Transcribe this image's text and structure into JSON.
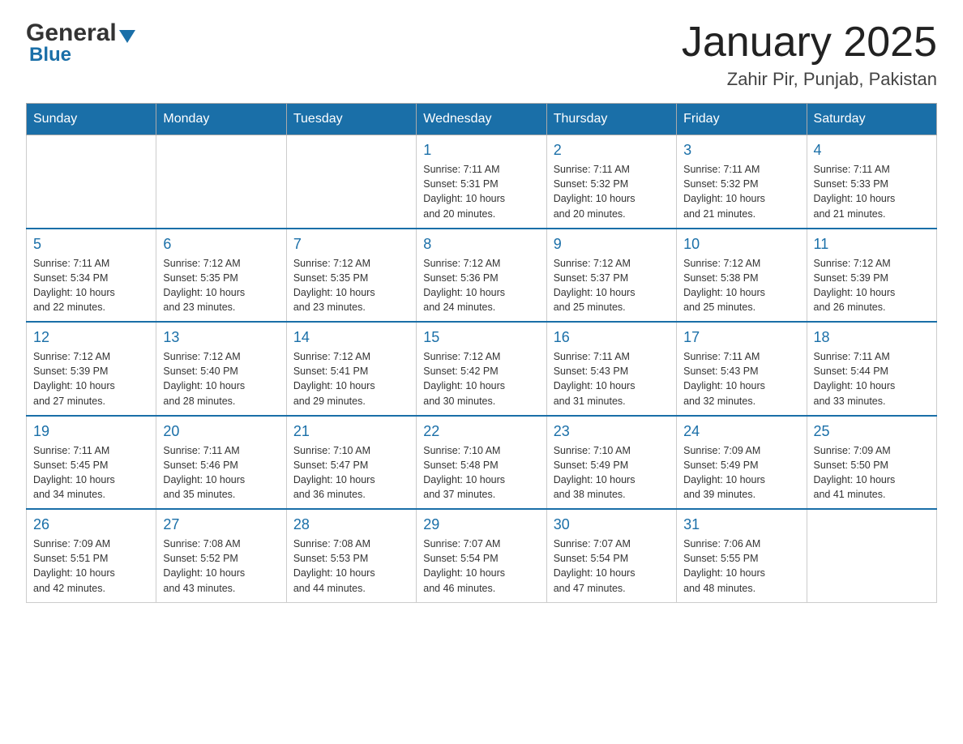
{
  "header": {
    "logo_general": "General",
    "logo_blue": "Blue",
    "month_title": "January 2025",
    "subtitle": "Zahir Pir, Punjab, Pakistan"
  },
  "days_of_week": [
    "Sunday",
    "Monday",
    "Tuesday",
    "Wednesday",
    "Thursday",
    "Friday",
    "Saturday"
  ],
  "weeks": [
    [
      {
        "day": "",
        "info": ""
      },
      {
        "day": "",
        "info": ""
      },
      {
        "day": "",
        "info": ""
      },
      {
        "day": "1",
        "info": "Sunrise: 7:11 AM\nSunset: 5:31 PM\nDaylight: 10 hours\nand 20 minutes."
      },
      {
        "day": "2",
        "info": "Sunrise: 7:11 AM\nSunset: 5:32 PM\nDaylight: 10 hours\nand 20 minutes."
      },
      {
        "day": "3",
        "info": "Sunrise: 7:11 AM\nSunset: 5:32 PM\nDaylight: 10 hours\nand 21 minutes."
      },
      {
        "day": "4",
        "info": "Sunrise: 7:11 AM\nSunset: 5:33 PM\nDaylight: 10 hours\nand 21 minutes."
      }
    ],
    [
      {
        "day": "5",
        "info": "Sunrise: 7:11 AM\nSunset: 5:34 PM\nDaylight: 10 hours\nand 22 minutes."
      },
      {
        "day": "6",
        "info": "Sunrise: 7:12 AM\nSunset: 5:35 PM\nDaylight: 10 hours\nand 23 minutes."
      },
      {
        "day": "7",
        "info": "Sunrise: 7:12 AM\nSunset: 5:35 PM\nDaylight: 10 hours\nand 23 minutes."
      },
      {
        "day": "8",
        "info": "Sunrise: 7:12 AM\nSunset: 5:36 PM\nDaylight: 10 hours\nand 24 minutes."
      },
      {
        "day": "9",
        "info": "Sunrise: 7:12 AM\nSunset: 5:37 PM\nDaylight: 10 hours\nand 25 minutes."
      },
      {
        "day": "10",
        "info": "Sunrise: 7:12 AM\nSunset: 5:38 PM\nDaylight: 10 hours\nand 25 minutes."
      },
      {
        "day": "11",
        "info": "Sunrise: 7:12 AM\nSunset: 5:39 PM\nDaylight: 10 hours\nand 26 minutes."
      }
    ],
    [
      {
        "day": "12",
        "info": "Sunrise: 7:12 AM\nSunset: 5:39 PM\nDaylight: 10 hours\nand 27 minutes."
      },
      {
        "day": "13",
        "info": "Sunrise: 7:12 AM\nSunset: 5:40 PM\nDaylight: 10 hours\nand 28 minutes."
      },
      {
        "day": "14",
        "info": "Sunrise: 7:12 AM\nSunset: 5:41 PM\nDaylight: 10 hours\nand 29 minutes."
      },
      {
        "day": "15",
        "info": "Sunrise: 7:12 AM\nSunset: 5:42 PM\nDaylight: 10 hours\nand 30 minutes."
      },
      {
        "day": "16",
        "info": "Sunrise: 7:11 AM\nSunset: 5:43 PM\nDaylight: 10 hours\nand 31 minutes."
      },
      {
        "day": "17",
        "info": "Sunrise: 7:11 AM\nSunset: 5:43 PM\nDaylight: 10 hours\nand 32 minutes."
      },
      {
        "day": "18",
        "info": "Sunrise: 7:11 AM\nSunset: 5:44 PM\nDaylight: 10 hours\nand 33 minutes."
      }
    ],
    [
      {
        "day": "19",
        "info": "Sunrise: 7:11 AM\nSunset: 5:45 PM\nDaylight: 10 hours\nand 34 minutes."
      },
      {
        "day": "20",
        "info": "Sunrise: 7:11 AM\nSunset: 5:46 PM\nDaylight: 10 hours\nand 35 minutes."
      },
      {
        "day": "21",
        "info": "Sunrise: 7:10 AM\nSunset: 5:47 PM\nDaylight: 10 hours\nand 36 minutes."
      },
      {
        "day": "22",
        "info": "Sunrise: 7:10 AM\nSunset: 5:48 PM\nDaylight: 10 hours\nand 37 minutes."
      },
      {
        "day": "23",
        "info": "Sunrise: 7:10 AM\nSunset: 5:49 PM\nDaylight: 10 hours\nand 38 minutes."
      },
      {
        "day": "24",
        "info": "Sunrise: 7:09 AM\nSunset: 5:49 PM\nDaylight: 10 hours\nand 39 minutes."
      },
      {
        "day": "25",
        "info": "Sunrise: 7:09 AM\nSunset: 5:50 PM\nDaylight: 10 hours\nand 41 minutes."
      }
    ],
    [
      {
        "day": "26",
        "info": "Sunrise: 7:09 AM\nSunset: 5:51 PM\nDaylight: 10 hours\nand 42 minutes."
      },
      {
        "day": "27",
        "info": "Sunrise: 7:08 AM\nSunset: 5:52 PM\nDaylight: 10 hours\nand 43 minutes."
      },
      {
        "day": "28",
        "info": "Sunrise: 7:08 AM\nSunset: 5:53 PM\nDaylight: 10 hours\nand 44 minutes."
      },
      {
        "day": "29",
        "info": "Sunrise: 7:07 AM\nSunset: 5:54 PM\nDaylight: 10 hours\nand 46 minutes."
      },
      {
        "day": "30",
        "info": "Sunrise: 7:07 AM\nSunset: 5:54 PM\nDaylight: 10 hours\nand 47 minutes."
      },
      {
        "day": "31",
        "info": "Sunrise: 7:06 AM\nSunset: 5:55 PM\nDaylight: 10 hours\nand 48 minutes."
      },
      {
        "day": "",
        "info": ""
      }
    ]
  ]
}
